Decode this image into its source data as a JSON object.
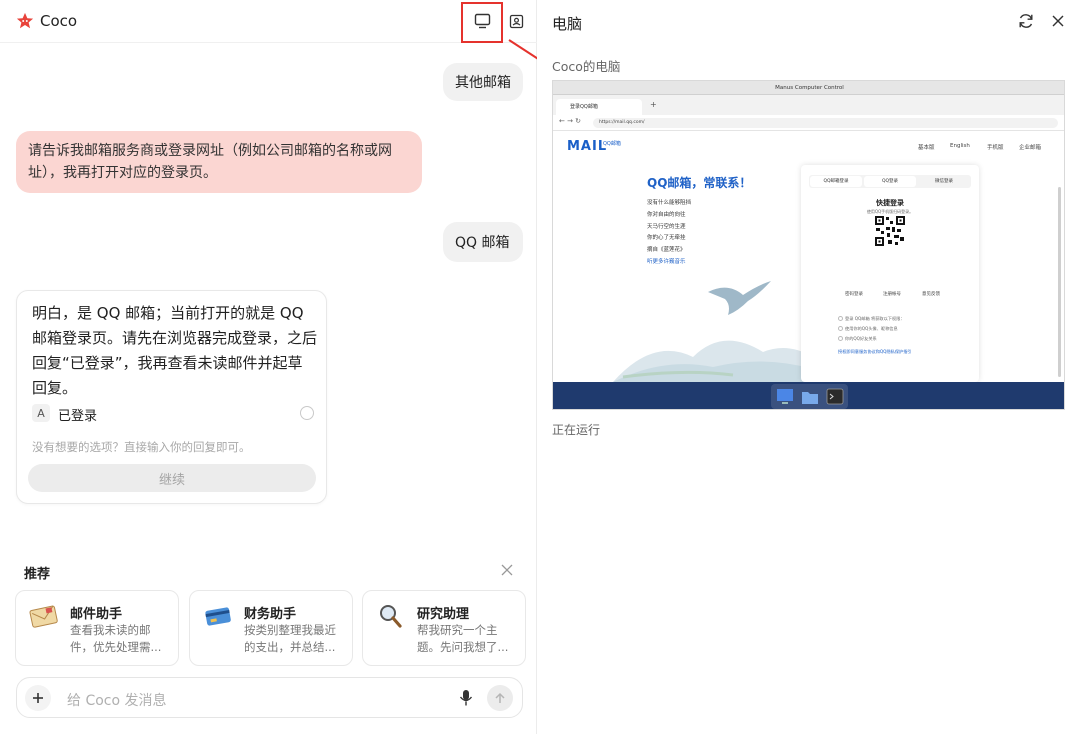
{
  "app": {
    "title": "Coco"
  },
  "chat": {
    "user_msg_1": "其他邮箱",
    "assistant_msg_1": "请告诉我邮箱服务商或登录网址（例如公司邮箱的名称或网址），我再打开对应的登录页。",
    "user_msg_2": "QQ 邮箱",
    "assistant_card": {
      "text": "明白，是 QQ 邮箱；当前打开的就是 QQ 邮箱登录页。请先在浏览器完成登录，之后回复“已登录”，我再查看未读邮件并起草回复。",
      "option_letter": "A",
      "option_label": "已登录",
      "hint": "没有想要的选项？直接输入你的回复即可。",
      "continue_label": "继续"
    }
  },
  "recommend": {
    "title": "推荐",
    "items": [
      {
        "name": "邮件助手",
        "desc": "查看我未读的邮件，优先处理需...",
        "icon": "mail-envelope-icon"
      },
      {
        "name": "财务助手",
        "desc": "按类别整理我最近的支出，并总结...",
        "icon": "credit-card-icon"
      },
      {
        "name": "研究助理",
        "desc": "帮我研究一个主题。先问我想了...",
        "icon": "magnifier-icon"
      }
    ]
  },
  "composer": {
    "placeholder": "给 Coco 发消息"
  },
  "computer_panel": {
    "title": "电脑",
    "subtitle": "Coco的电脑",
    "status": "正在运行",
    "screenshot": {
      "window_title": "Manus Computer Control",
      "tab_title": "登录QQ邮箱",
      "url": "https://mail.qq.com/",
      "logo": "MAIL",
      "logo_sub": "QQ邮箱",
      "nav": [
        "基本版",
        "English",
        "手机版",
        "企业邮箱"
      ],
      "hero": "QQ邮箱，常联系！",
      "poem": [
        "没有什么能够阻挡",
        "你对自由的向往",
        "天马行空的生涯",
        "你的心了无牵挂",
        "摘自《蓝莲花》"
      ],
      "music_link": "听更多许巍音乐",
      "login_tabs": [
        "QQ邮箱登录",
        "QQ登录",
        "微信登录"
      ],
      "quick_login": "快捷登录",
      "quick_sub": "使用QQ手机版扫码登录。",
      "links": [
        "密码登录",
        "注册帐号",
        "意见反馈"
      ],
      "options": [
        "登录 QQ邮箱 将获取以下权限：",
        "使用你的QQ头像、昵称信息",
        "你的QQ好友关系"
      ],
      "agreement": "授权即同意服务协议和QQ隐私保护指引"
    }
  }
}
